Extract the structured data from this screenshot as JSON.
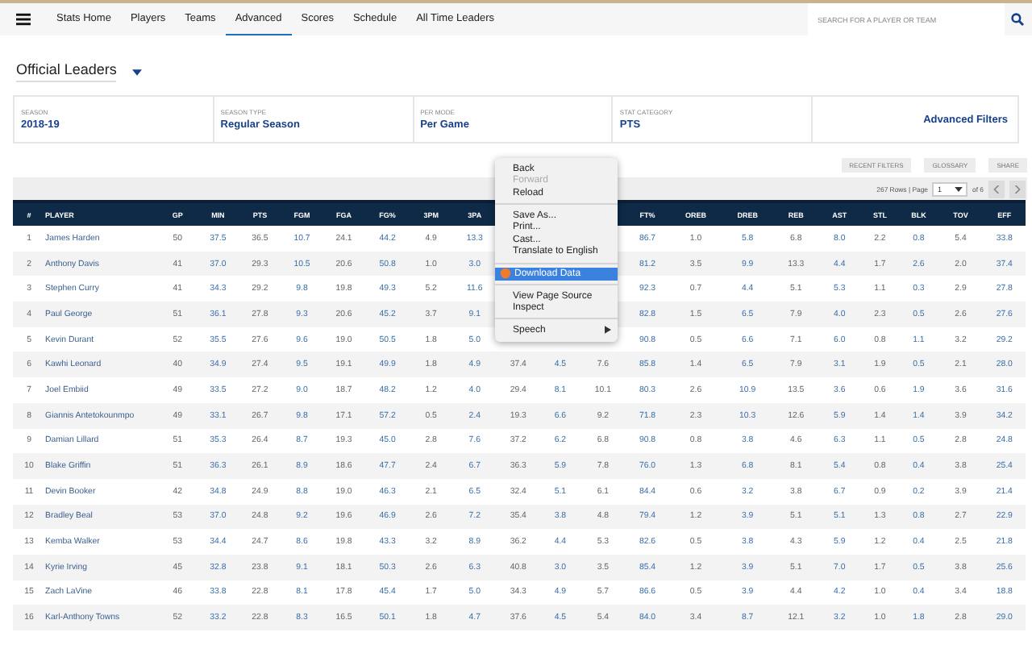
{
  "nav": {
    "items": [
      {
        "label": "Stats Home",
        "selected": false
      },
      {
        "label": "Players",
        "selected": false
      },
      {
        "label": "Teams",
        "selected": false
      },
      {
        "label": "Advanced",
        "selected": true
      },
      {
        "label": "Scores",
        "selected": false
      },
      {
        "label": "Schedule",
        "selected": false
      },
      {
        "label": "All Time Leaders",
        "selected": false
      }
    ],
    "search": {
      "placeholder": "SEARCH FOR A PLAYER OR TEAM"
    }
  },
  "title": "Official Leaders",
  "filters": [
    {
      "label": "SEASON",
      "value": "2018-19"
    },
    {
      "label": "SEASON TYPE",
      "value": "Regular Season"
    },
    {
      "label": "PER MODE",
      "value": "Per Game"
    },
    {
      "label": "STAT CATEGORY",
      "value": "PTS"
    }
  ],
  "advanced_filters": "Advanced Filters",
  "tools": [
    "RECENT FILTERS",
    "GLOSSARY",
    "SHARE"
  ],
  "pagination": {
    "rows": "267 Rows | Page",
    "page": "1",
    "of": "of 6"
  },
  "table": {
    "columns": [
      "#",
      "PLAYER",
      "GP",
      "MIN",
      "PTS",
      "FGM",
      "FGA",
      "FG%",
      "3PM",
      "3PA",
      null,
      null,
      null,
      "FT%",
      "OREB",
      "DREB",
      "REB",
      "AST",
      "STL",
      "BLK",
      "TOV",
      "EFF"
    ],
    "rows": [
      [
        "1",
        "James Harden",
        "50",
        "37.5",
        "36.5",
        "10.7",
        "24.1",
        "44.2",
        "4.9",
        "13.3",
        null,
        null,
        null,
        "86.7",
        "1.0",
        "5.8",
        "6.8",
        "8.0",
        "2.2",
        "0.8",
        "5.4",
        "33.8"
      ],
      [
        "2",
        "Anthony Davis",
        "41",
        "37.0",
        "29.3",
        "10.5",
        "20.6",
        "50.8",
        "1.0",
        "3.0",
        null,
        null,
        null,
        "81.2",
        "3.5",
        "9.9",
        "13.3",
        "4.4",
        "1.7",
        "2.6",
        "2.0",
        "37.4"
      ],
      [
        "3",
        "Stephen Curry",
        "41",
        "34.3",
        "29.2",
        "9.8",
        "19.8",
        "49.3",
        "5.2",
        "11.6",
        null,
        null,
        null,
        "92.3",
        "0.7",
        "4.4",
        "5.1",
        "5.3",
        "1.1",
        "0.3",
        "2.9",
        "27.8"
      ],
      [
        "4",
        "Paul George",
        "51",
        "36.1",
        "27.8",
        "9.3",
        "20.6",
        "45.2",
        "3.7",
        "9.1",
        null,
        null,
        null,
        "82.8",
        "1.5",
        "6.5",
        "7.9",
        "4.0",
        "2.3",
        "0.5",
        "2.6",
        "27.6"
      ],
      [
        "5",
        "Kevin Durant",
        "52",
        "35.5",
        "27.6",
        "9.6",
        "19.0",
        "50.5",
        "1.8",
        "5.0",
        null,
        null,
        null,
        "90.8",
        "0.5",
        "6.6",
        "7.1",
        "6.0",
        "0.8",
        "1.1",
        "3.2",
        "29.2"
      ],
      [
        "6",
        "Kawhi Leonard",
        "40",
        "34.9",
        "27.4",
        "9.5",
        "19.1",
        "49.9",
        "1.8",
        "4.9",
        "37.4",
        "4.5",
        "7.6",
        "85.8",
        "1.4",
        "6.5",
        "7.9",
        "3.1",
        "1.9",
        "0.5",
        "2.1",
        "28.0"
      ],
      [
        "7",
        "Joel Embiid",
        "49",
        "33.5",
        "27.2",
        "9.0",
        "18.7",
        "48.2",
        "1.2",
        "4.0",
        "29.4",
        "8.1",
        "10.1",
        "80.3",
        "2.6",
        "10.9",
        "13.5",
        "3.6",
        "0.6",
        "1.9",
        "3.6",
        "31.6"
      ],
      [
        "8",
        "Giannis Antetokounmpo",
        "49",
        "33.1",
        "26.7",
        "9.8",
        "17.1",
        "57.2",
        "0.5",
        "2.4",
        "19.3",
        "6.6",
        "9.2",
        "71.8",
        "2.3",
        "10.3",
        "12.6",
        "5.9",
        "1.4",
        "1.4",
        "3.9",
        "34.2"
      ],
      [
        "9",
        "Damian Lillard",
        "51",
        "35.3",
        "26.4",
        "8.7",
        "19.3",
        "45.0",
        "2.8",
        "7.6",
        "37.2",
        "6.2",
        "6.8",
        "90.8",
        "0.8",
        "3.8",
        "4.6",
        "6.3",
        "1.1",
        "0.5",
        "2.8",
        "24.8"
      ],
      [
        "10",
        "Blake Griffin",
        "51",
        "36.3",
        "26.1",
        "8.9",
        "18.6",
        "47.7",
        "2.4",
        "6.7",
        "36.3",
        "5.9",
        "7.8",
        "76.0",
        "1.3",
        "6.8",
        "8.1",
        "5.4",
        "0.8",
        "0.4",
        "3.8",
        "25.4"
      ],
      [
        "11",
        "Devin Booker",
        "42",
        "34.8",
        "24.9",
        "8.8",
        "19.0",
        "46.3",
        "2.1",
        "6.5",
        "32.4",
        "5.1",
        "6.1",
        "84.4",
        "0.6",
        "3.2",
        "3.8",
        "6.7",
        "0.9",
        "0.2",
        "3.9",
        "21.4"
      ],
      [
        "12",
        "Bradley Beal",
        "53",
        "37.0",
        "24.8",
        "9.2",
        "19.6",
        "46.9",
        "2.6",
        "7.2",
        "35.4",
        "3.8",
        "4.8",
        "79.4",
        "1.2",
        "3.9",
        "5.1",
        "5.1",
        "1.3",
        "0.8",
        "2.7",
        "22.9"
      ],
      [
        "13",
        "Kemba Walker",
        "53",
        "34.4",
        "24.7",
        "8.6",
        "19.8",
        "43.3",
        "3.2",
        "8.9",
        "36.2",
        "4.4",
        "5.3",
        "82.6",
        "0.5",
        "3.8",
        "4.3",
        "5.9",
        "1.2",
        "0.4",
        "2.5",
        "21.8"
      ],
      [
        "14",
        "Kyrie Irving",
        "45",
        "32.8",
        "23.8",
        "9.1",
        "18.1",
        "50.3",
        "2.6",
        "6.3",
        "40.8",
        "3.0",
        "3.5",
        "85.4",
        "1.2",
        "3.9",
        "5.1",
        "7.0",
        "1.7",
        "0.5",
        "3.8",
        "25.6"
      ],
      [
        "15",
        "Zach LaVine",
        "46",
        "33.8",
        "22.8",
        "8.1",
        "17.8",
        "45.4",
        "1.7",
        "5.0",
        "34.3",
        "4.9",
        "5.7",
        "86.6",
        "0.5",
        "3.9",
        "4.4",
        "4.2",
        "1.0",
        "0.4",
        "3.4",
        "18.8"
      ],
      [
        "16",
        "Karl-Anthony Towns",
        "52",
        "33.2",
        "22.8",
        "8.3",
        "16.5",
        "50.1",
        "1.8",
        "4.7",
        "37.6",
        "4.5",
        "5.4",
        "84.0",
        "3.4",
        "8.7",
        "12.1",
        "3.2",
        "1.0",
        "1.8",
        "2.8",
        "29.0"
      ]
    ]
  },
  "context_menu": [
    {
      "kind": "item",
      "label": "Back",
      "disabled": false,
      "selected": false
    },
    {
      "kind": "item",
      "label": "Forward",
      "disabled": true,
      "selected": false
    },
    {
      "kind": "item",
      "label": "Reload",
      "disabled": false,
      "selected": false
    },
    {
      "kind": "separator"
    },
    {
      "kind": "item",
      "label": "Save As...",
      "disabled": false,
      "selected": false
    },
    {
      "kind": "item",
      "label": "Print...",
      "disabled": false,
      "selected": false
    },
    {
      "kind": "item",
      "label": "Cast...",
      "disabled": false,
      "selected": false
    },
    {
      "kind": "item",
      "label": "Translate to English",
      "disabled": false,
      "selected": false
    },
    {
      "kind": "separator"
    },
    {
      "kind": "item",
      "label": "Download Data",
      "disabled": false,
      "selected": true,
      "has_icon": true
    },
    {
      "kind": "separator"
    },
    {
      "kind": "item",
      "label": "View Page Source",
      "disabled": false,
      "selected": false
    },
    {
      "kind": "item",
      "label": "Inspect",
      "disabled": false,
      "selected": false
    },
    {
      "kind": "separator"
    },
    {
      "kind": "item",
      "label": "Speech",
      "disabled": false,
      "selected": false,
      "has_submenu": true
    }
  ]
}
